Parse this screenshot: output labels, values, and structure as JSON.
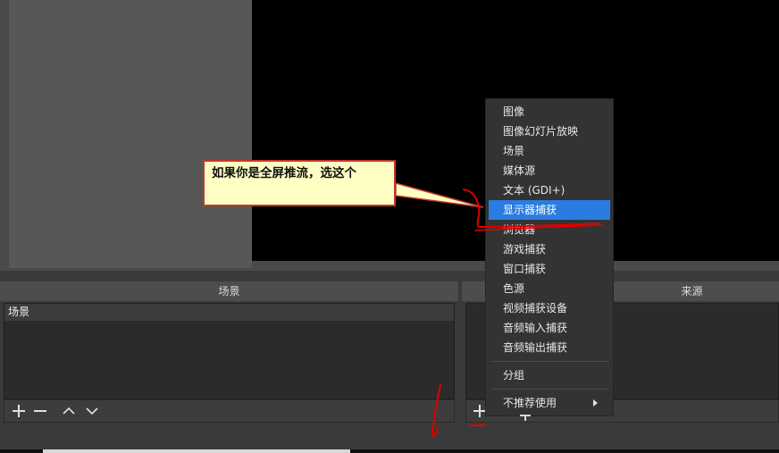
{
  "docks": {
    "scenes": {
      "title": "场景",
      "items": [
        {
          "label": "场景"
        }
      ]
    },
    "sources": {
      "title": "来源"
    }
  },
  "context_menu": {
    "items": [
      {
        "label": "图像"
      },
      {
        "label": "图像幻灯片放映"
      },
      {
        "label": "场景"
      },
      {
        "label": "媒体源"
      },
      {
        "label": "文本 (GDI+)"
      },
      {
        "label": "显示器捕获",
        "highlighted": true
      },
      {
        "label": "浏览器"
      },
      {
        "label": "游戏捕获"
      },
      {
        "label": "窗口捕获"
      },
      {
        "label": "色源"
      },
      {
        "label": "视频捕获设备"
      },
      {
        "label": "音频输入捕获"
      },
      {
        "label": "音频输出捕获"
      }
    ],
    "group_label": "分组",
    "deprecated_label": "不推荐使用"
  },
  "annotation": {
    "callout_text": "如果你是全屏推流，选这个",
    "line_color": "#e00000",
    "highlight_color": "#2a7ce0"
  },
  "icons": [
    "plus-icon",
    "minus-icon",
    "chevron-up-icon",
    "chevron-down-icon",
    "submenu-arrow-icon"
  ]
}
